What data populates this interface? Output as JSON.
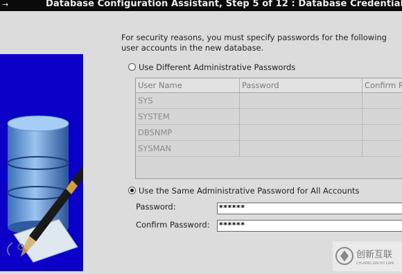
{
  "window": {
    "title": "Database Configuration Assistant, Step 5 of 12 : Database Credentials",
    "menu_arrow": "→"
  },
  "intro_text": "For security reasons, you must specify passwords for the following user accounts in the new database.",
  "option_different": {
    "label": "Use Different Administrative Passwords",
    "selected": false
  },
  "users_table": {
    "columns": [
      "User Name",
      "Password",
      "Confirm Password"
    ],
    "rows": [
      {
        "user": "SYS",
        "password": "",
        "confirm": ""
      },
      {
        "user": "SYSTEM",
        "password": "",
        "confirm": ""
      },
      {
        "user": "DBSNMP",
        "password": "",
        "confirm": ""
      },
      {
        "user": "SYSMAN",
        "password": "",
        "confirm": ""
      }
    ]
  },
  "option_same": {
    "label": "Use the Same Administrative Password for All Accounts",
    "selected": true
  },
  "password_field": {
    "label": "Password:",
    "value": "******"
  },
  "confirm_field": {
    "label": "Confirm Password:",
    "value": "******"
  },
  "watermark": {
    "text_cn": "创新互联",
    "text_en": "CHUANG XIN HU LIAN"
  },
  "colors": {
    "side_panel": "#0b00c8",
    "titlebar": "#0a0a0a",
    "background": "#dcdcdc"
  }
}
